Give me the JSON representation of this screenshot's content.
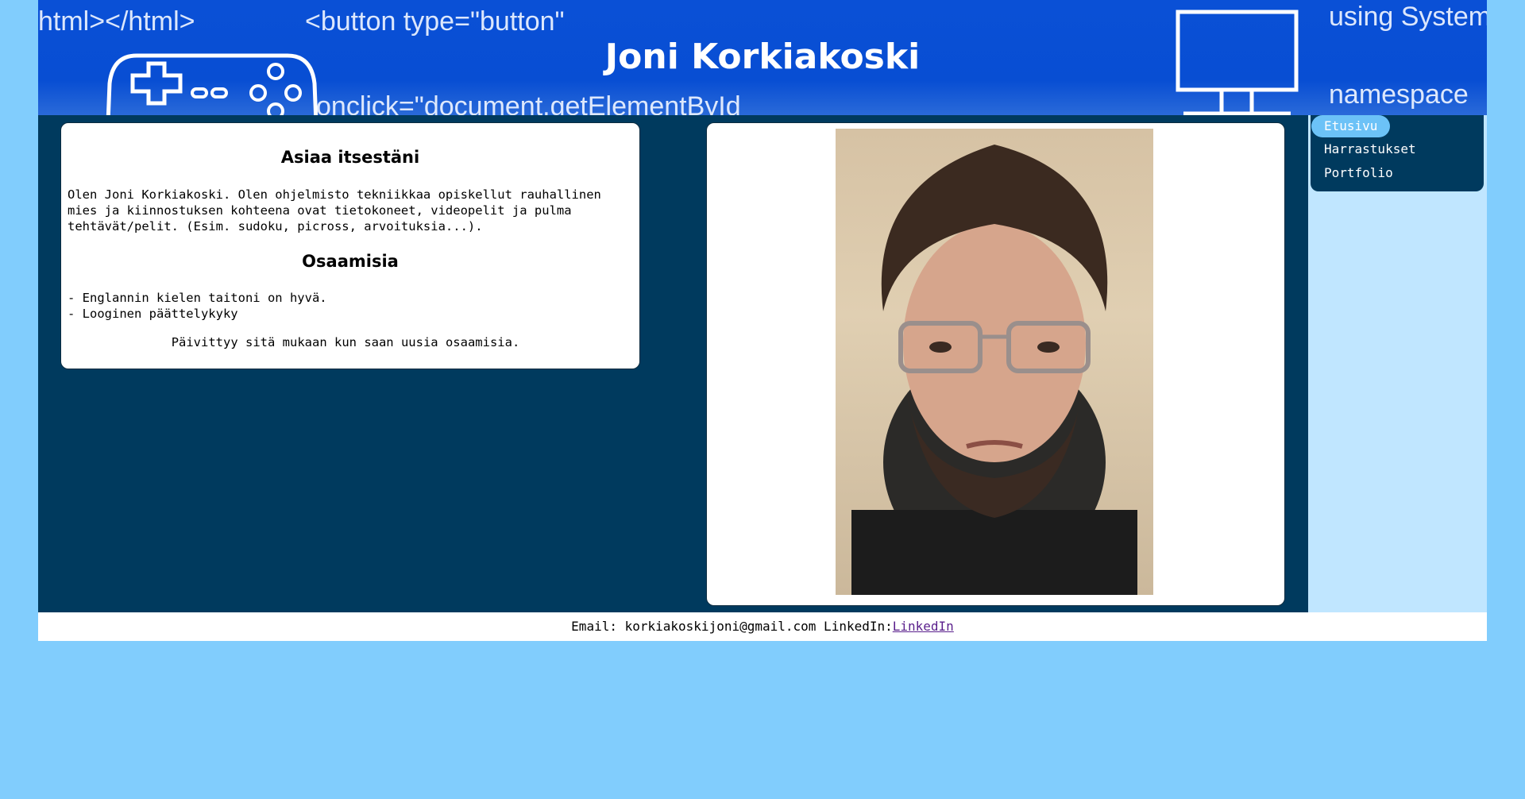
{
  "header": {
    "title": "Joni Korkiakoski",
    "bg_code": {
      "line1": "html></html>",
      "line2": "<button type=\"button\"",
      "line3": "onclick=\"document.getElementById",
      "line4": "using System",
      "line5": "namespace"
    }
  },
  "about": {
    "heading": "Asiaa itsestäni",
    "text": "Olen Joni Korkiakoski. Olen ohjelmisto tekniikkaa opiskellut rauhallinen mies ja kiinnostuksen kohteena ovat tietokoneet, videopelit ja pulma tehtävät/pelit. (Esim. sudoku, picross, arvoituksia...).",
    "skills_heading": "Osaamisia",
    "skills": [
      "- Englannin kielen taitoni on hyvä.",
      "- Looginen päättelykyky"
    ],
    "note": "Päivittyy sitä mukaan kun saan uusia osaamisia."
  },
  "nav": {
    "items": [
      {
        "label": "Etusivu",
        "active": true
      },
      {
        "label": "Harrastukset",
        "active": false
      },
      {
        "label": "Portfolio",
        "active": false
      }
    ]
  },
  "footer": {
    "email_text": "Email: korkiakoskijoni@gmail.com LinkedIn:",
    "link_label": "LinkedIn"
  },
  "colors": {
    "page_bg": "#81cdfd",
    "header_blue": "#0a50d6",
    "main_bg": "#003a5e",
    "nav_column_bg": "#c0e6ff",
    "nav_active_bg": "#6cc2f7",
    "link": "#5a1f8c"
  }
}
